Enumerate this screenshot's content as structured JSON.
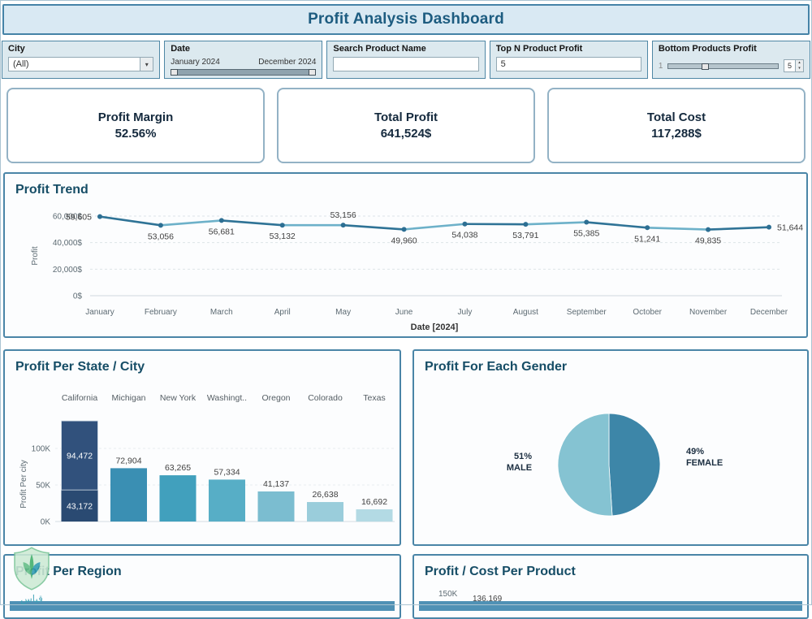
{
  "header": {
    "title": "Profit Analysis Dashboard"
  },
  "icons": {
    "dropdown_arrow": "▾",
    "spin_up": "▴",
    "spin_down": "▾"
  },
  "filters": {
    "city": {
      "label": "City",
      "value": "(All)"
    },
    "date": {
      "label": "Date",
      "start": "January 2024",
      "end": "December 2024"
    },
    "search": {
      "label": "Search Product Name",
      "value": ""
    },
    "top_n": {
      "label": "Top N Product Profit",
      "value": "5"
    },
    "bottom": {
      "label": "Bottom Products Profit",
      "min": "1",
      "value": "5"
    }
  },
  "kpis": [
    {
      "label": "Profit Margin",
      "value": "52.56%"
    },
    {
      "label": "Total Profit",
      "value": "641,524$"
    },
    {
      "label": "Total Cost",
      "value": "117,288$"
    }
  ],
  "sections": {
    "trend_title": "Profit Trend",
    "state_title": "Profit Per State / City",
    "gender_title": "Profit For Each Gender",
    "region_title": "Profit Per Region",
    "product_title": "Profit / Cost Per Product",
    "product_axis_tick": "150K",
    "product_first_label": "136,169"
  },
  "watermark": {
    "text": "قياس"
  },
  "colors": {
    "accent_dark": "#1d5c80",
    "border_teal": "#4a85a7",
    "line_dark": "#2f7396",
    "line_light": "#6db1c9",
    "strip_blue": "#4f91b5"
  },
  "chart_data": [
    {
      "type": "line",
      "title": "Profit Trend",
      "x": [
        "January",
        "February",
        "March",
        "April",
        "May",
        "June",
        "July",
        "August",
        "September",
        "October",
        "November",
        "December"
      ],
      "values": [
        59605,
        53056,
        56681,
        53132,
        53156,
        49960,
        54038,
        53791,
        55385,
        51241,
        49835,
        51644
      ],
      "labels": [
        "59,605",
        "53,056",
        "56,681",
        "53,132",
        "53,156",
        "49,960",
        "54,038",
        "53,791",
        "55,385",
        "51,241",
        "49,835",
        "51,644"
      ],
      "xlabel": "Date [2024]",
      "ylabel": "Profit",
      "yticks": [
        {
          "v": 0,
          "label": "0$"
        },
        {
          "v": 20000,
          "label": "20,000$"
        },
        {
          "v": 40000,
          "label": "40,000$"
        },
        {
          "v": 60000,
          "label": "60,000$"
        }
      ],
      "ylim": [
        0,
        60000
      ],
      "grid": "dashed-horizontal",
      "legend": "none"
    },
    {
      "type": "bar",
      "title": "Profit Per State / City",
      "ylabel": "Profit Per city",
      "categories": [
        "California",
        "Michigan",
        "New York",
        "Washingt..",
        "Oregon",
        "Colorado",
        "Texas"
      ],
      "bars": [
        {
          "stack": [
            {
              "value": 43172,
              "label": "43,172"
            },
            {
              "value": 94472,
              "label": "94,472"
            }
          ]
        },
        {
          "value": 72904,
          "label": "72,904"
        },
        {
          "value": 63265,
          "label": "63,265"
        },
        {
          "value": 57334,
          "label": "57,334"
        },
        {
          "value": 41137,
          "label": "41,137"
        },
        {
          "value": 26638,
          "label": "26,638"
        },
        {
          "value": 16692,
          "label": "16,692"
        }
      ],
      "yticks": [
        {
          "v": 0,
          "label": "0K"
        },
        {
          "v": 50000,
          "label": "50K"
        },
        {
          "v": 100000,
          "label": "100K"
        }
      ],
      "ylim": [
        0,
        145000
      ],
      "bar_colors": [
        "#31517c",
        "#3a8fb3",
        "#41a0bd",
        "#57aec6",
        "#7bbdd0",
        "#9acddb",
        "#b3dae4"
      ],
      "stack_colors": [
        "#2a4a72",
        "#31517c"
      ],
      "legend": "none"
    },
    {
      "type": "pie",
      "title": "Profit For Each Gender",
      "slices": [
        {
          "name": "FEMALE",
          "pct": 49,
          "pct_label": "49%",
          "color": "#3d86a8"
        },
        {
          "name": "MALE",
          "pct": 51,
          "pct_label": "51%",
          "color": "#85c3d2"
        }
      ],
      "legend": "none"
    }
  ]
}
